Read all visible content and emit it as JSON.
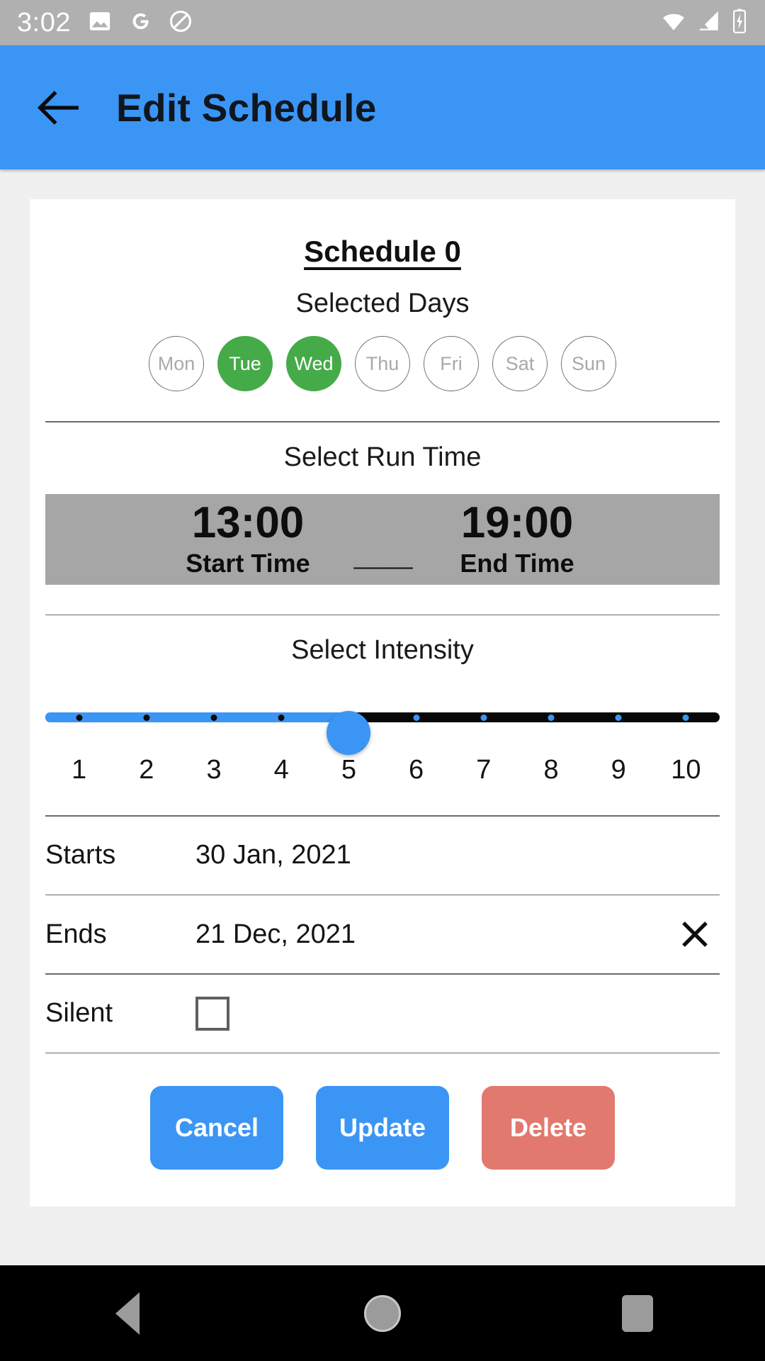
{
  "status_bar": {
    "time": "3:02",
    "left_icons": [
      "image-icon",
      "google-icon",
      "do-not-disturb-icon"
    ],
    "right_icons": [
      "wifi-icon",
      "cellular-signal-icon",
      "battery-charging-icon"
    ]
  },
  "app_bar": {
    "back_icon": "arrow-back-icon",
    "title": "Edit Schedule",
    "background": "#3b95f5"
  },
  "card": {
    "schedule_title": "Schedule 0",
    "days": {
      "label": "Selected Days",
      "selected_color": "#45ab48",
      "items": [
        {
          "label": "Mon",
          "selected": false
        },
        {
          "label": "Tue",
          "selected": true
        },
        {
          "label": "Wed",
          "selected": true
        },
        {
          "label": "Thu",
          "selected": false
        },
        {
          "label": "Fri",
          "selected": false
        },
        {
          "label": "Sat",
          "selected": false
        },
        {
          "label": "Sun",
          "selected": false
        }
      ]
    },
    "run_time": {
      "label": "Select Run Time",
      "start_value": "13:00",
      "start_caption": "Start Time",
      "separator": "___",
      "end_value": "19:00",
      "end_caption": "End Time",
      "band_color": "#a6a6a6"
    },
    "intensity": {
      "label": "Select Intensity",
      "value": 5,
      "min": 1,
      "max": 10,
      "scale": [
        "1",
        "2",
        "3",
        "4",
        "5",
        "6",
        "7",
        "8",
        "9",
        "10"
      ],
      "active_color": "#3b95f5",
      "inactive_color": "#080808"
    },
    "starts": {
      "label": "Starts",
      "value": "30 Jan, 2021"
    },
    "ends": {
      "label": "Ends",
      "value": "21 Dec, 2021",
      "clear_icon": "close-icon"
    },
    "silent": {
      "label": "Silent",
      "checked": false
    },
    "actions": [
      {
        "label": "Cancel",
        "style": "primary"
      },
      {
        "label": "Update",
        "style": "primary"
      },
      {
        "label": "Delete",
        "style": "danger"
      }
    ]
  },
  "nav_bar": {
    "back": "back-triangle-icon",
    "home": "home-circle-icon",
    "recents": "recents-square-icon"
  }
}
